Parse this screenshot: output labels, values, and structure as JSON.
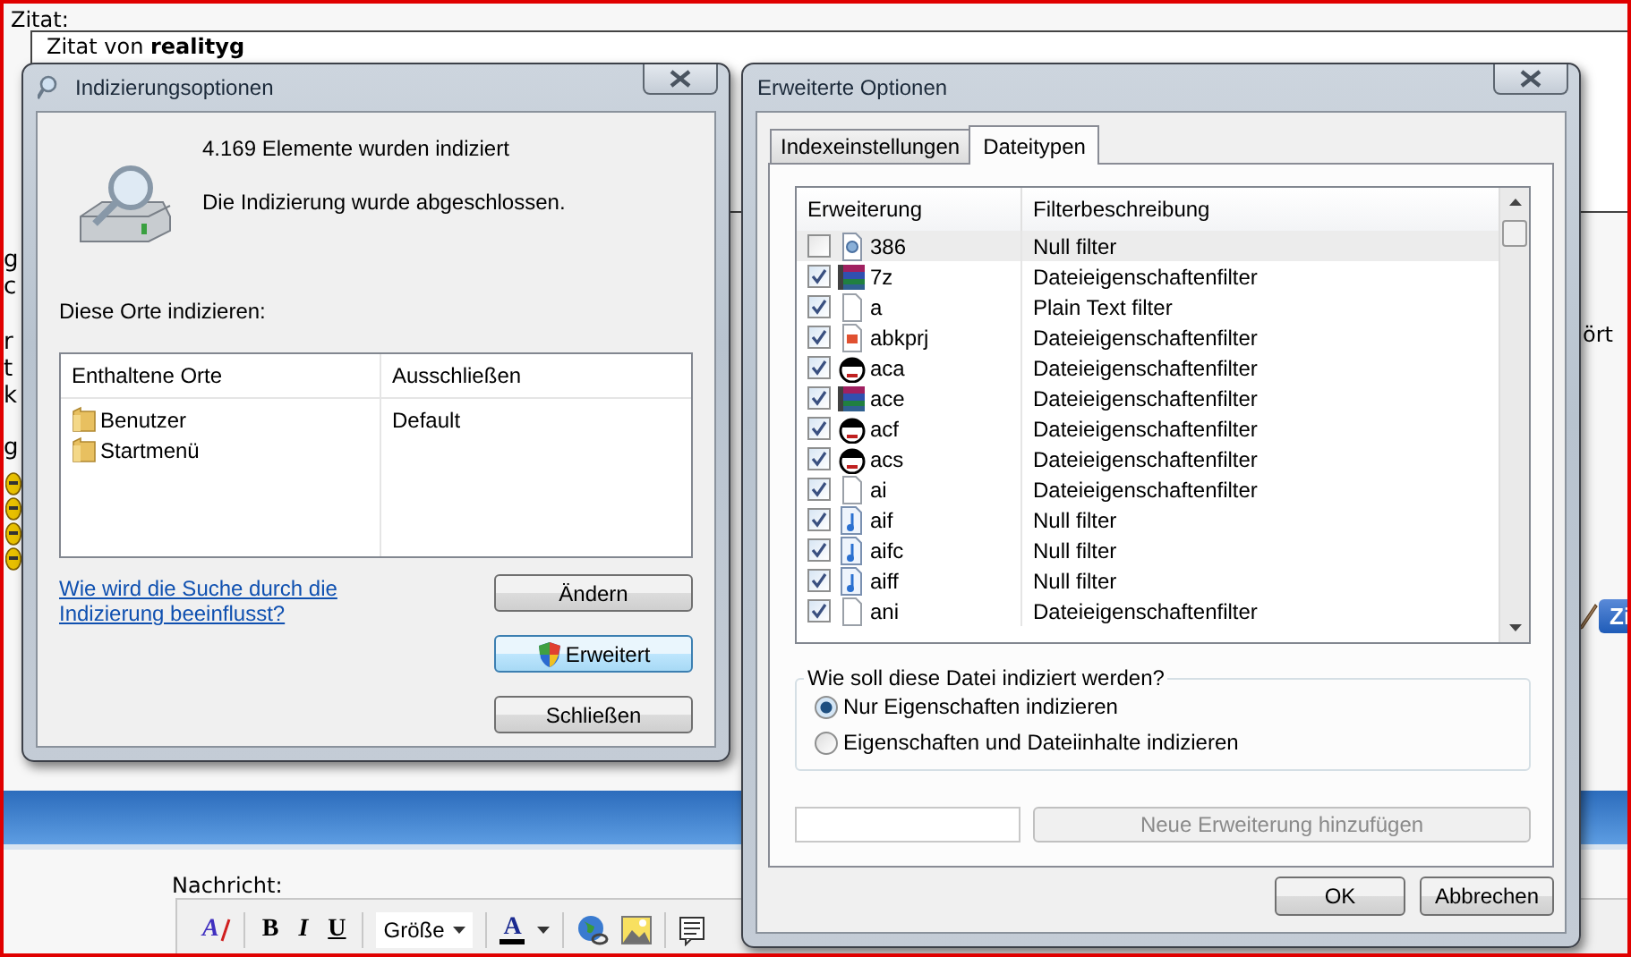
{
  "background_page": {
    "quote_label": "Zitat:",
    "quote_author": "Zitat von **realityg**",
    "edge_fragments": [
      "g",
      "c",
      "r",
      "t",
      "k",
      "g"
    ],
    "right_fragment": "ört",
    "quote_button": "Zi",
    "message_label": "Nachricht:",
    "editor_toolbar": {
      "clear_format": "A",
      "format_buttons": [
        "B",
        "I",
        "U"
      ],
      "size_select": "Größe",
      "color_button": "A"
    }
  },
  "indexing_window": {
    "title": "Indizierungsoptionen",
    "count_text": "4.169 Elemente wurden indiziert",
    "status_text": "Die Indizierung wurde abgeschlossen.",
    "locations_label": "Diese Orte indizieren:",
    "columns": [
      "Enthaltene Orte",
      "Ausschließen"
    ],
    "rows": [
      {
        "location": "Benutzer",
        "exclude": "Default"
      },
      {
        "location": "Startmenü"
      }
    ],
    "help_link": "Wie wird die Suche durch die Indizierung beeinflusst?",
    "buttons": [
      {
        "label": "Ändern",
        "kind": "plain",
        "highlighted": false
      },
      {
        "label": "Erweitert",
        "kind": "shield",
        "highlighted": true
      },
      {
        "label": "Schließen",
        "kind": "plain",
        "highlighted": false
      }
    ]
  },
  "advanced_window": {
    "title": "Erweiterte Optionen",
    "tabs": [
      {
        "label": "Indexeinstellungen",
        "selected": false
      },
      {
        "label": "Dateitypen",
        "selected": true
      }
    ],
    "columns": [
      "Erweiterung",
      "Filterbeschreibung"
    ],
    "rows": [
      {
        "checked": false,
        "kind": "gear",
        "extension": "386",
        "filter": "Null filter",
        "selected": true
      },
      {
        "checked": true,
        "kind": "archive",
        "extension": "7z",
        "filter": "Dateieigenschaftenfilter",
        "selected": false
      },
      {
        "checked": true,
        "kind": "blank",
        "extension": "a",
        "filter": "Plain Text filter",
        "selected": false
      },
      {
        "checked": true,
        "kind": "image",
        "extension": "abkprj",
        "filter": "Dateieigenschaftenfilter",
        "selected": false
      },
      {
        "checked": true,
        "kind": "mascot",
        "extension": "aca",
        "filter": "Dateieigenschaftenfilter",
        "selected": false
      },
      {
        "checked": true,
        "kind": "archive",
        "extension": "ace",
        "filter": "Dateieigenschaftenfilter",
        "selected": false
      },
      {
        "checked": true,
        "kind": "mascot",
        "extension": "acf",
        "filter": "Dateieigenschaftenfilter",
        "selected": false
      },
      {
        "checked": true,
        "kind": "mascot",
        "extension": "acs",
        "filter": "Dateieigenschaftenfilter",
        "selected": false
      },
      {
        "checked": true,
        "kind": "blank",
        "extension": "ai",
        "filter": "Dateieigenschaftenfilter",
        "selected": false
      },
      {
        "checked": true,
        "kind": "audio",
        "extension": "aif",
        "filter": "Null filter",
        "selected": false
      },
      {
        "checked": true,
        "kind": "audio",
        "extension": "aifc",
        "filter": "Null filter",
        "selected": false
      },
      {
        "checked": true,
        "kind": "audio",
        "extension": "aiff",
        "filter": "Null filter",
        "selected": false
      },
      {
        "checked": true,
        "kind": "blank",
        "extension": "ani",
        "filter": "Dateieigenschaftenfilter",
        "selected": false
      }
    ],
    "group_label": "Wie soll diese Datei indiziert werden?",
    "options": [
      {
        "label": "Nur Eigenschaften indizieren",
        "selected": true
      },
      {
        "label": "Eigenschaften und Dateiinhalte indizieren",
        "selected": false
      }
    ],
    "add_button": {
      "label": "Neue Erweiterung hinzufügen",
      "disabled": true
    },
    "buttons": [
      "OK",
      "Abbrechen"
    ]
  }
}
